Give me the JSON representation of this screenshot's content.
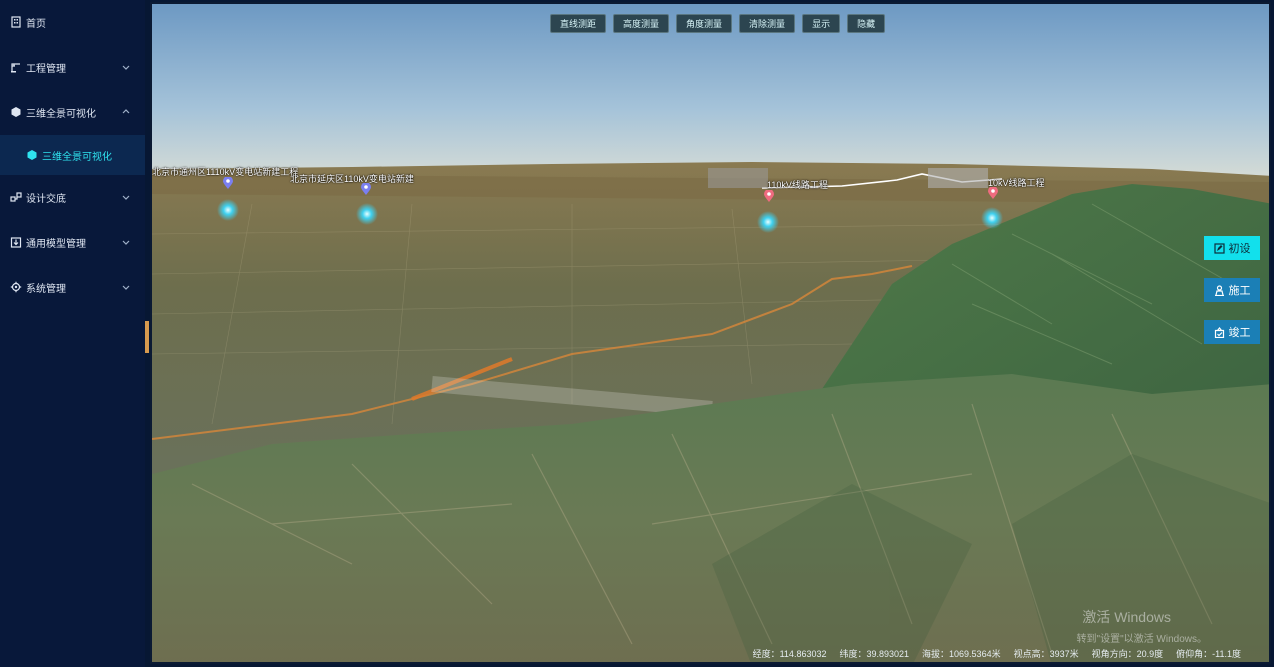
{
  "sidebar": {
    "items": [
      {
        "label": "首页",
        "icon": "building-icon",
        "expandable": false
      },
      {
        "label": "工程管理",
        "icon": "crane-icon",
        "expandable": true
      },
      {
        "label": "三维全景可视化",
        "icon": "cube-icon",
        "expandable": true,
        "expanded": true
      },
      {
        "label": "三维全景可视化",
        "icon": "cube-icon",
        "sub": true,
        "active": true
      },
      {
        "label": "设计交底",
        "icon": "share-icon",
        "expandable": true
      },
      {
        "label": "通用模型管理",
        "icon": "download-icon",
        "expandable": true
      },
      {
        "label": "系统管理",
        "icon": "gear-icon",
        "expandable": true
      }
    ]
  },
  "toolbar": {
    "buttons": [
      "直线测距",
      "高度测量",
      "角度测量",
      "清除测量",
      "显示",
      "隐藏"
    ]
  },
  "map_labels": [
    {
      "text": "北京市通州区1110kV变电站新建工程",
      "color": "blue"
    },
    {
      "text": "北京市延庆区110kV变电站新建",
      "color": "blue"
    },
    {
      "text": "110kV线路工程",
      "color": "red"
    },
    {
      "text": "10kV线路工程",
      "color": "red"
    }
  ],
  "phase_buttons": [
    {
      "label": "初设",
      "icon": "edit-icon",
      "active": true
    },
    {
      "label": "施工",
      "icon": "worker-icon",
      "active": false
    },
    {
      "label": "竣工",
      "icon": "check-icon",
      "active": false
    }
  ],
  "status": {
    "longitude": "经度：114.863032",
    "latitude": "纬度：39.893021",
    "altitude": "海拔：1069.5364米",
    "view_height": "视点高：3937米",
    "heading": "视角方向：20.9度",
    "pitch": "俯仰角：-11.1度"
  },
  "watermark": {
    "line1": "激活 Windows",
    "line2": "转到\"设置\"以激活 Windows。"
  },
  "colors": {
    "sidebar_bg": "#08183a",
    "accent_cyan": "#12e0ec",
    "button_blue": "#1b7fb6"
  }
}
